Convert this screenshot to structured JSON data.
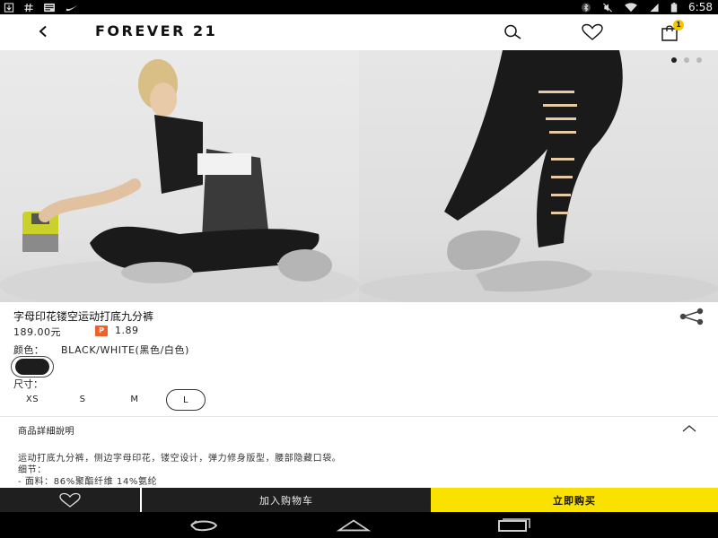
{
  "status_bar": {
    "time": "6:58",
    "left_icons": [
      "download-icon",
      "hash-icon",
      "message-icon",
      "nike-icon"
    ],
    "right_icons": [
      "bluetooth-icon",
      "mute-icon",
      "wifi-icon",
      "signal-icon",
      "battery-icon"
    ]
  },
  "header": {
    "brand": "FOREVER 21",
    "cart_count": "1"
  },
  "gallery": {
    "image_count": 3,
    "active_index": 0
  },
  "product": {
    "title": "字母印花镂空运动打底九分裤",
    "price": "189.00元",
    "points_badge": "P",
    "points": "1.89",
    "color_label": "颜色：",
    "color_value": "BLACK/WHITE(黑色/白色)",
    "swatch_color": "#1d1d1d",
    "size_label": "尺寸：",
    "sizes": [
      "XS",
      "S",
      "M",
      "L"
    ],
    "selected_size": "L"
  },
  "details": {
    "heading": "商品詳細說明",
    "line1": "运动打底九分裤，侧边字母印花，镂空设计，弹力修身版型，腰部隐藏口袋。",
    "line2": "细节：",
    "line3": "- 面料：86%聚酯纤维 14%氨纶"
  },
  "actions": {
    "add_to_cart": "加入购物车",
    "buy_now": "立即购买"
  },
  "colors": {
    "accent_yellow": "#f9e100",
    "dark_bar": "#1f1f1f",
    "points_badge": "#f0602a"
  }
}
